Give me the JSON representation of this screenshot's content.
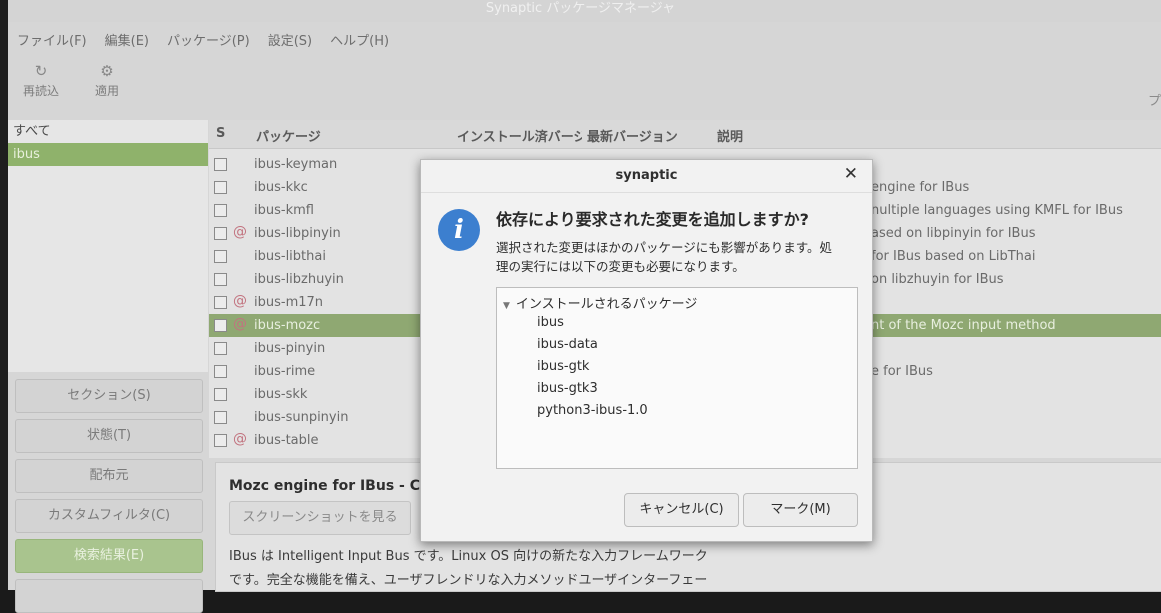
{
  "window": {
    "title": "Synaptic パッケージマネージャ"
  },
  "menu": [
    "ファイル(F)",
    "編集(E)",
    "パッケージ(P)",
    "設定(S)",
    "ヘルプ(H)"
  ],
  "toolbar": {
    "reload": {
      "icon": "refresh-icon",
      "label": "再読込"
    },
    "apply": {
      "icon": "gear-icon",
      "label": "適用"
    },
    "right_fragment": "プ"
  },
  "sidebar": {
    "categories": [
      "すべて",
      "ibus"
    ],
    "buttons": [
      "セクション(S)",
      "状態(T)",
      "配布元",
      "カスタムフィルタ(C)",
      "検索結果(E)"
    ]
  },
  "package_list": {
    "columns": {
      "s": "S",
      "package": "パッケージ",
      "installed": "インストール済バージョン",
      "latest": "最新バージョン",
      "description": "説明"
    },
    "rows": [
      {
        "name": "ibus-keyman",
        "desc": ""
      },
      {
        "name": "ibus-kkc",
        "desc": "engine for IBus"
      },
      {
        "name": "ibus-kmfl",
        "desc": "nultiple languages using KMFL for IBus"
      },
      {
        "name": "ibus-libpinyin",
        "desc": "ased on libpinyin for IBus"
      },
      {
        "name": "ibus-libthai",
        "desc": "for IBus based on LibThai"
      },
      {
        "name": "ibus-libzhuyin",
        "desc": "on libzhuyin for IBus"
      },
      {
        "name": "ibus-m17n",
        "desc": ""
      },
      {
        "name": "ibus-mozc",
        "desc": "nt of the Mozc input method"
      },
      {
        "name": "ibus-pinyin",
        "desc": ""
      },
      {
        "name": "ibus-rime",
        "desc": "e for IBus"
      },
      {
        "name": "ibus-skk",
        "desc": ""
      },
      {
        "name": "ibus-sunpinyin",
        "desc": ""
      },
      {
        "name": "ibus-table",
        "desc": ""
      }
    ]
  },
  "details": {
    "title": "Mozc engine for IBus - Clie",
    "screenshot_button": "スクリーンショットを見る",
    "text_line1": "IBus は Intelligent Input Bus です。Linux OS 向けの新たな入力フレームワーク",
    "text_line2": "です。完全な機能を備え、ユーザフレンドリな入力メソッドユーザインターフェー"
  },
  "dialog": {
    "title": "synaptic",
    "close_icon": "close-icon",
    "info_icon": "info-icon",
    "heading": "依存により要求された変更を追加しますか?",
    "body_line1": "選択された変更はほかのパッケージにも影響があります。処",
    "body_line2": "理の実行には以下の変更も必要になります。",
    "tree_parent": "インストールされるパッケージ",
    "tree_children": [
      "ibus",
      "ibus-data",
      "ibus-gtk",
      "ibus-gtk3",
      "python3-ibus-1.0"
    ],
    "cancel_label": "キャンセル(C)",
    "mark_label": "マーク(M)"
  },
  "colors": {
    "selection_green": "#8fb26b",
    "info_blue": "#3c7fcf",
    "debian_swirl": "#c2737f"
  }
}
